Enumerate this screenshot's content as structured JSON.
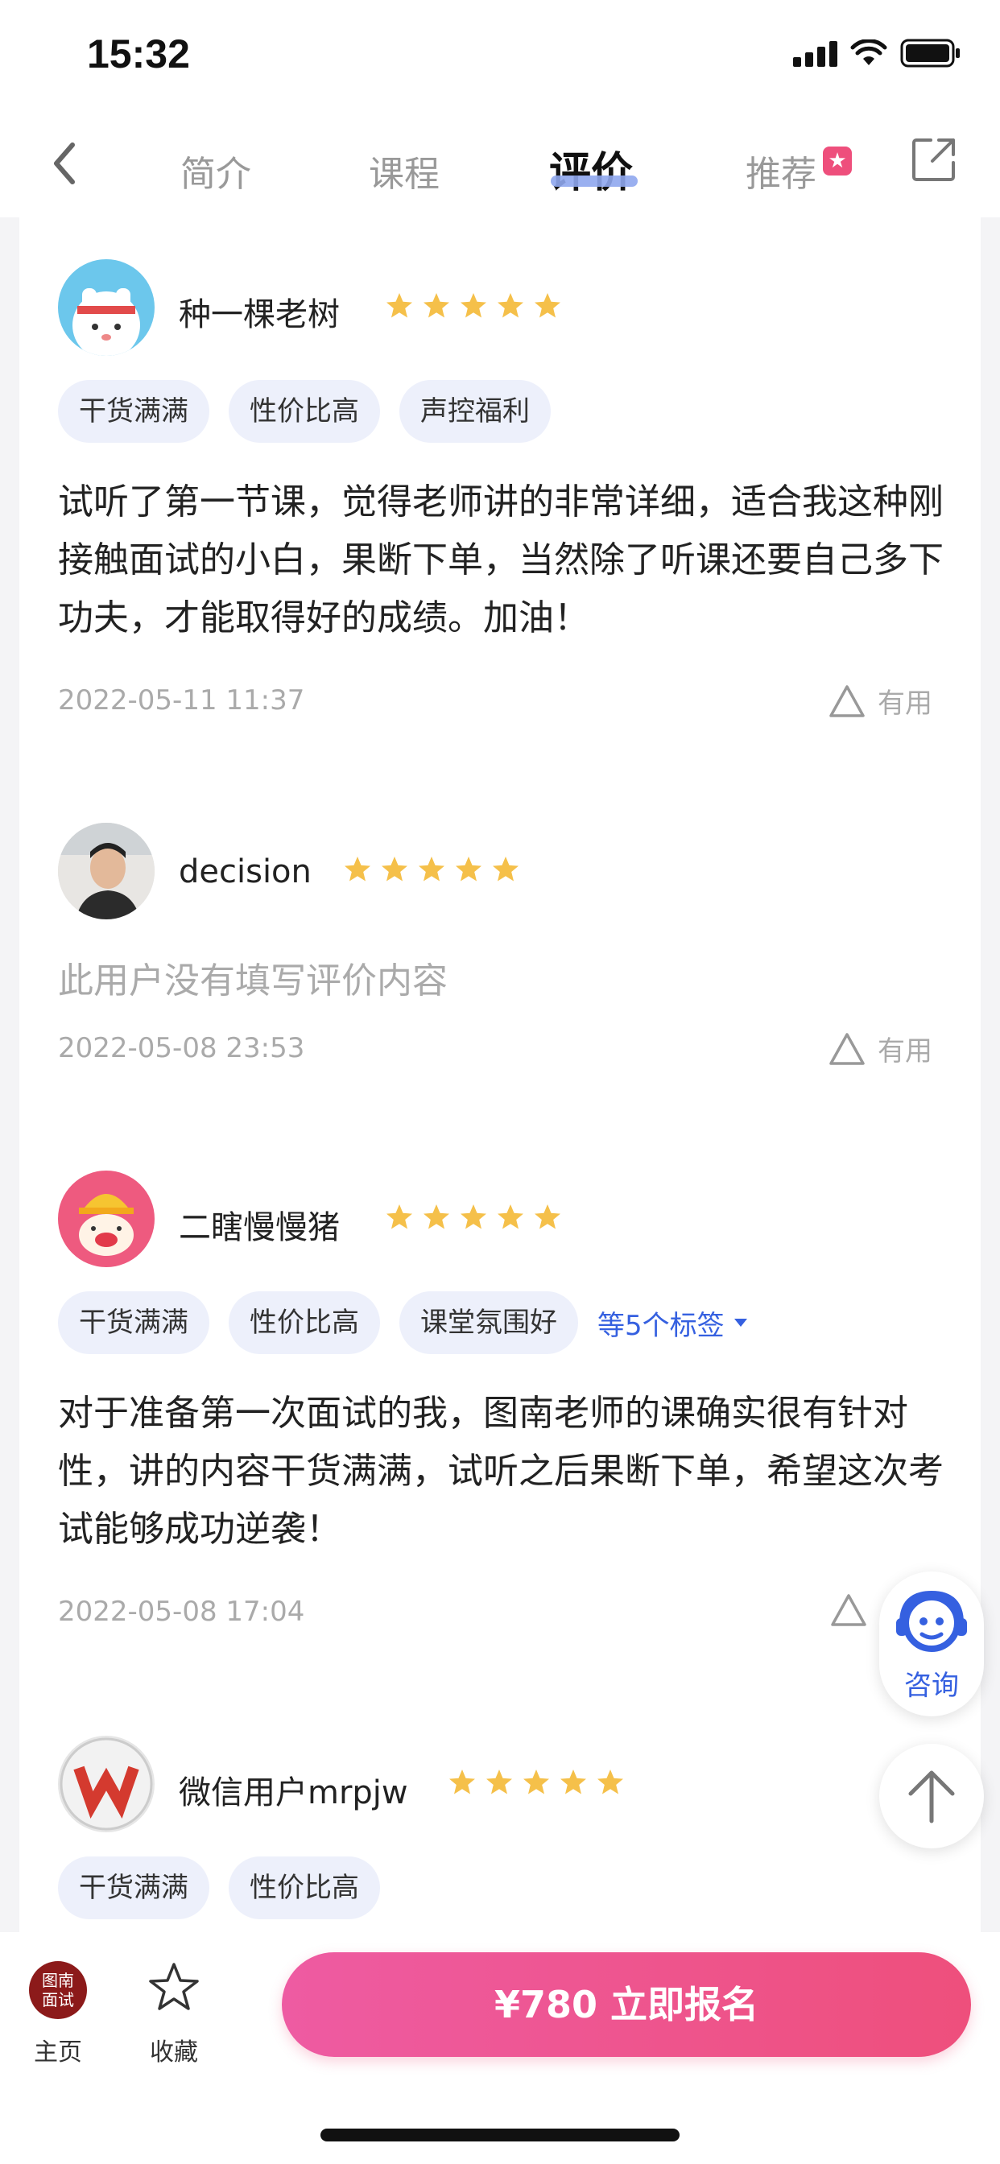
{
  "status_bar": {
    "time": "15:32"
  },
  "nav": {
    "tabs": [
      {
        "label": "简介",
        "active": false
      },
      {
        "label": "课程",
        "active": false
      },
      {
        "label": "评价",
        "active": true
      },
      {
        "label": "推荐",
        "active": false
      }
    ],
    "recommend_badge": "★",
    "accent_color": "#3560e0",
    "brand_color": "#ee4f7c"
  },
  "reviews": [
    {
      "username": "种一棵老树",
      "rating": 5,
      "tags": [
        "干货满满",
        "性价比高",
        "声控福利"
      ],
      "text": "试听了第一节课，觉得老师讲的非常详细，适合我这种刚接触面试的小白，果断下单，当然除了听课还要自己多下功夫，才能取得好的成绩。加油！",
      "date": "2022-05-11 11:37",
      "useful_label": "有用"
    },
    {
      "username": "decision",
      "rating": 5,
      "empty_text": "此用户没有填写评价内容",
      "date": "2022-05-08 23:53",
      "useful_label": "有用"
    },
    {
      "username": "二瞎慢慢猪",
      "rating": 5,
      "tags": [
        "干货满满",
        "性价比高",
        "课堂氛围好"
      ],
      "more_tags": "等5个标签",
      "text": "对于准备第一次面试的我，图南老师的课确实很有针对性，讲的内容干货满满，试听之后果断下单，希望这次考试能够成功逆袭！",
      "date": "2022-05-08 17:04"
    },
    {
      "username": "微信用户mrpjw",
      "rating": 5,
      "tags": [
        "干货满满",
        "性价比高"
      ]
    }
  ],
  "floating": {
    "consult_label": "咨询"
  },
  "bottom_bar": {
    "home_logo_line1": "图南",
    "home_logo_line2": "面试",
    "home_label": "主页",
    "favorite_label": "收藏",
    "cta_label": "¥780  立即报名"
  }
}
